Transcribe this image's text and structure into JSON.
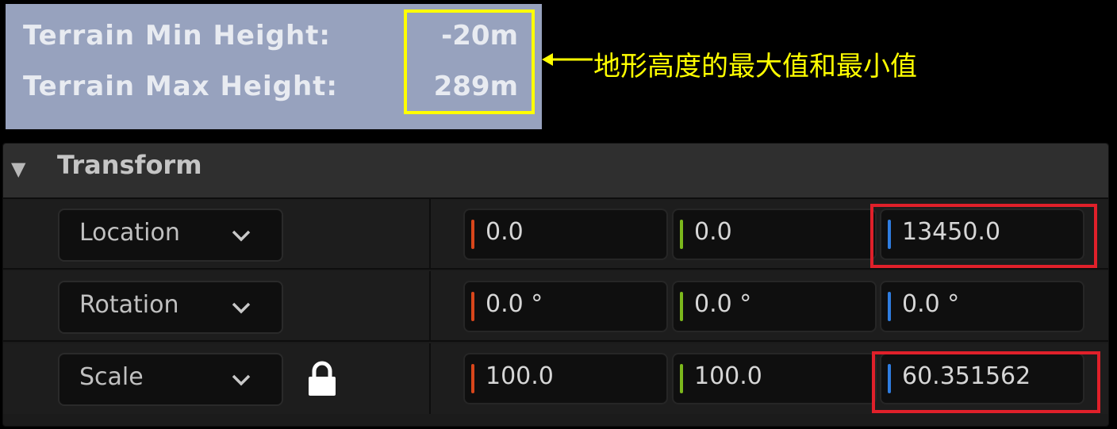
{
  "terrain_info": {
    "min_label": "Terrain Min Height:",
    "min_value": "-20m",
    "max_label": "Terrain Max Height:",
    "max_value": "289m"
  },
  "annotation": {
    "caption": "地形高度的最大值和最小值"
  },
  "transform": {
    "title": "Transform",
    "rows": [
      {
        "label": "Location",
        "x": "0.0",
        "y": "0.0",
        "z": "13450.0"
      },
      {
        "label": "Rotation",
        "x": "0.0 °",
        "y": "0.0 °",
        "z": "0.0 °"
      },
      {
        "label": "Scale",
        "x": "100.0",
        "y": "100.0",
        "z": "60.351562"
      }
    ]
  },
  "colors": {
    "x_axis": "#d8461b",
    "y_axis": "#7cb81c",
    "z_axis": "#2f7de0",
    "highlight_yellow": "#ffff00",
    "highlight_red": "#e0202a"
  },
  "icons": {
    "collapse": "triangle-down-icon",
    "dropdown": "chevron-down-icon",
    "lock": "lock-icon",
    "arrow": "arrow-left-icon"
  }
}
